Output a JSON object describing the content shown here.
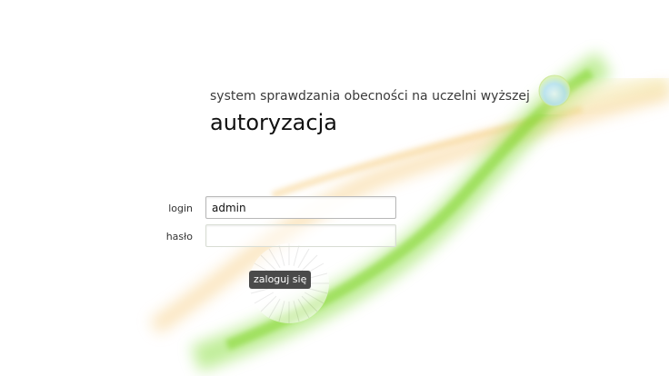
{
  "header": {
    "subtitle": "system sprawdzania obecności na uczelni wyższej",
    "title": "autoryzacja"
  },
  "form": {
    "login_label": "login",
    "login_value": "admin",
    "password_label": "hasło",
    "password_value": "",
    "submit_label": "zaloguj się"
  },
  "colors": {
    "accent_green": "#7ed321",
    "accent_orange": "#f5c873",
    "button_bg": "#4a4a4a"
  },
  "icons": {
    "decoration": "bubble-circle-icon",
    "button_glow": "sunburst-glow-icon"
  }
}
